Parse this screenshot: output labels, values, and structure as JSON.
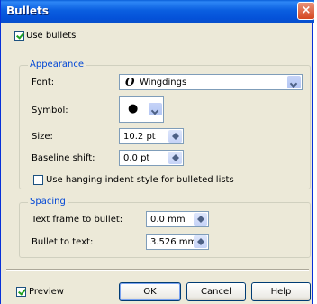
{
  "window": {
    "title": "Bullets",
    "close_glyph": "×"
  },
  "use_bullets": {
    "label": "Use bullets",
    "checked": true
  },
  "appearance": {
    "legend": "Appearance",
    "font": {
      "label": "Font:",
      "value": "Wingdings",
      "icon": "opentype-font-icon",
      "icon_glyph": "O"
    },
    "symbol": {
      "label": "Symbol:",
      "value": "●"
    },
    "size": {
      "label": "Size:",
      "value": "10.2 pt"
    },
    "baseline_shift": {
      "label": "Baseline shift:",
      "value": "0.0 pt"
    },
    "hanging_indent": {
      "label": "Use hanging indent style for bulleted lists",
      "checked": false
    }
  },
  "spacing": {
    "legend": "Spacing",
    "text_frame_to_bullet": {
      "label": "Text frame to bullet:",
      "value": "0.0 mm"
    },
    "bullet_to_text": {
      "label": "Bullet to text:",
      "value": "3.526 mm"
    }
  },
  "footer": {
    "preview": {
      "label": "Preview",
      "checked": true
    },
    "ok_label": "OK",
    "cancel_label": "Cancel",
    "help_label": "Help"
  }
}
